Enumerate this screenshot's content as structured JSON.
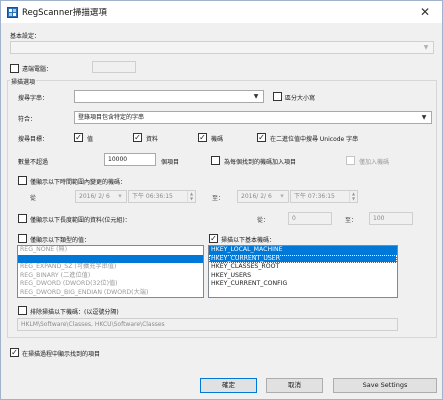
{
  "window": {
    "title": "RegScanner掃描選項",
    "close_glyph": "✕",
    "icon": "regscanner-app-icon"
  },
  "base_settings_label": "基本設定：",
  "remote_computer": {
    "label": "遠端電腦：",
    "checked": false
  },
  "scan_options_group": "掃描選項",
  "find_string": {
    "label": "搜尋字串：",
    "value": "",
    "case_label": "區分大小寫",
    "case_checked": false
  },
  "match": {
    "label": "符合：",
    "value": "登錄項目包含特定的字串"
  },
  "targets": {
    "label": "搜尋目標：",
    "values": {
      "label": "值",
      "checked": true
    },
    "data": {
      "label": "資料",
      "checked": true
    },
    "keys": {
      "label": "機碼",
      "checked": true
    },
    "unicode": {
      "label": "在二進位值中搜尋 Unicode 字串",
      "checked": true
    }
  },
  "stop_after": {
    "label": "數量不超過",
    "value": "10000",
    "unit": "個項目",
    "add_label": "為每個找到的機碼加入項目",
    "add_checked": false,
    "add_keys_label": "僅加入機碼",
    "add_keys_checked": false
  },
  "time_range": {
    "label": "僅顯示以下時間範圍內變更的機碼：",
    "checked": false,
    "from_label": "從",
    "from_date": "2016/ 2/ 6",
    "from_time": "下午 06:36:15",
    "to_label": "至：",
    "to_date": "2016/ 2/ 6",
    "to_time": "下午 07:36:15"
  },
  "length_range": {
    "label": "僅顯示以下長度範圍的資料(位元組)：",
    "checked": false,
    "from_label": "從：",
    "from_value": "0",
    "to_label": "至：",
    "to_value": "100"
  },
  "value_types": {
    "label": "僅顯示以下類型的值：",
    "checked": false,
    "items": [
      "REG_NONE (無)",
      "REG_SZ (字串)",
      "REG_EXPAND_SZ (可擴充字串值)",
      "REG_BINARY (二進位值)",
      "REG_DWORD (DWORD(32位)值)",
      "REG_DWORD_BIG_ENDIAN (DWORD(大端)"
    ]
  },
  "base_keys": {
    "label": "掃描以下基本機碼：",
    "checked": true,
    "items": [
      "HKEY_LOCAL_MACHINE",
      "HKEY_CURRENT_USER",
      "HKEY_CLASSES_ROOT",
      "HKEY_USERS",
      "HKEY_CURRENT_CONFIG"
    ]
  },
  "exclude": {
    "label": "排除掃描以下機碼：(以逗號分隔)",
    "checked": false,
    "value": "HKLM\\Software\\Classes, HKCU\\Software\\Classes"
  },
  "show_during_scan": {
    "label": "在掃描過程中顯示找到的項目",
    "checked": true
  },
  "buttons": {
    "ok": "確定",
    "cancel": "取消",
    "save": "Save Settings"
  },
  "colors": {
    "selection": "#0078d7",
    "accent_border": "#0078d7"
  }
}
